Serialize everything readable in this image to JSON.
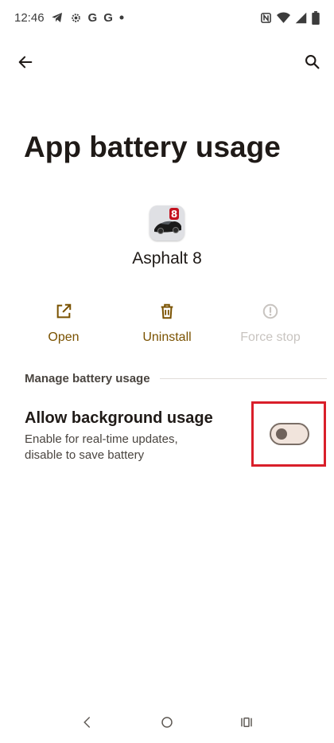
{
  "status_bar": {
    "time": "12:46",
    "left_icons": [
      "telegram-icon",
      "settings-gear-icon",
      "google-icon",
      "google-icon",
      "dot-icon"
    ],
    "g1": "G",
    "g2": "G",
    "right_icons": [
      "nfc-icon",
      "wifi-icon",
      "cellular-signal-icon",
      "battery-icon"
    ]
  },
  "toolbar": {
    "back_icon": "arrow-back-icon",
    "search_icon": "search-icon"
  },
  "page": {
    "title": "App battery usage"
  },
  "app": {
    "name": "Asphalt 8",
    "icon": "asphalt-8-app-icon"
  },
  "actions": [
    {
      "label": "Open",
      "icon": "open-external-icon",
      "enabled": true
    },
    {
      "label": "Uninstall",
      "icon": "trash-icon",
      "enabled": true
    },
    {
      "label": "Force stop",
      "icon": "alert-circle-icon",
      "enabled": false
    }
  ],
  "section": {
    "header": "Manage battery usage"
  },
  "preference": {
    "title": "Allow background usage",
    "summary_line1": "Enable for real-time updates,",
    "summary_line2": "disable to save battery",
    "switch_on": false
  },
  "colors": {
    "accent": "#7a5200",
    "disabled": "#c8c4c0",
    "highlight": "#d91f2a"
  },
  "nav_bar": {
    "icons": [
      "nav-back-icon",
      "nav-home-icon",
      "nav-recents-icon"
    ]
  }
}
